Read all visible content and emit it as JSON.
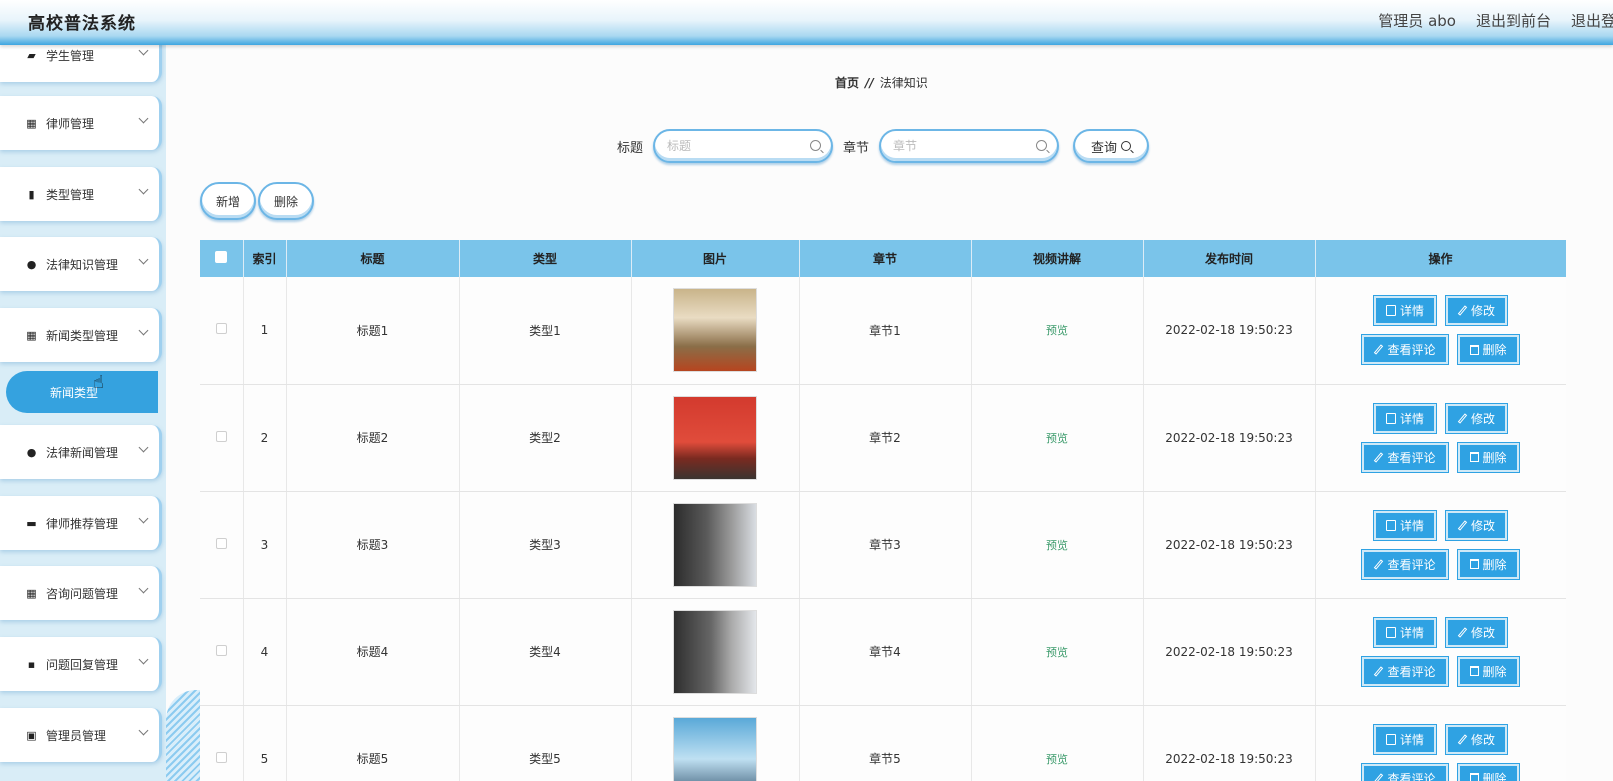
{
  "header": {
    "title": "高校普法系统",
    "links": [
      "管理员 abo",
      "退出到前台",
      "退出登录"
    ]
  },
  "sidebar": {
    "items": [
      {
        "label": "学生管理",
        "icon": "briefcase-icon"
      },
      {
        "label": "律师管理",
        "icon": "grid-icon"
      },
      {
        "label": "类型管理",
        "icon": "book-icon"
      },
      {
        "label": "法律知识管理",
        "icon": "user-icon"
      },
      {
        "label": "新闻类型管理",
        "icon": "grid-icon"
      },
      {
        "label": "法律新闻管理",
        "icon": "user-icon"
      },
      {
        "label": "律师推荐管理",
        "icon": "printer-icon"
      },
      {
        "label": "咨询问题管理",
        "icon": "grid-icon"
      },
      {
        "label": "问题回复管理",
        "icon": "wallet-icon"
      },
      {
        "label": "管理员管理",
        "icon": "clipboard-icon"
      }
    ],
    "active_sub": "新闻类型"
  },
  "breadcrumb": {
    "home": "首页",
    "separator": "//",
    "current": "法律知识"
  },
  "search": {
    "title_label": "标题",
    "title_placeholder": "标题",
    "chapter_label": "章节",
    "chapter_placeholder": "章节",
    "query_label": "查询"
  },
  "actions": {
    "add": "新增",
    "delete": "删除"
  },
  "table": {
    "columns": [
      "索引",
      "标题",
      "类型",
      "图片",
      "章节",
      "视频讲解",
      "发布时间",
      "操作"
    ],
    "rows": [
      {
        "index": "1",
        "title": "标题1",
        "type": "类型1",
        "chapter": "章节1",
        "video": "预览",
        "time": "2022-02-18 19:50:23"
      },
      {
        "index": "2",
        "title": "标题2",
        "type": "类型2",
        "chapter": "章节2",
        "video": "预览",
        "time": "2022-02-18 19:50:23"
      },
      {
        "index": "3",
        "title": "标题3",
        "type": "类型3",
        "chapter": "章节3",
        "video": "预览",
        "time": "2022-02-18 19:50:23"
      },
      {
        "index": "4",
        "title": "标题4",
        "type": "类型4",
        "chapter": "章节4",
        "video": "预览",
        "time": "2022-02-18 19:50:23"
      },
      {
        "index": "5",
        "title": "标题5",
        "type": "类型5",
        "chapter": "章节5",
        "video": "预览",
        "time": "2022-02-18 19:50:23"
      }
    ],
    "row_actions": {
      "detail": "详情",
      "edit": "修改",
      "comments": "查看评论",
      "delete": "删除"
    }
  },
  "colors": {
    "accent": "#2fa2e3",
    "header_row": "#7ac4ea",
    "sidebar_bg": "#d9edf7",
    "active_sub": "#35a2df"
  }
}
